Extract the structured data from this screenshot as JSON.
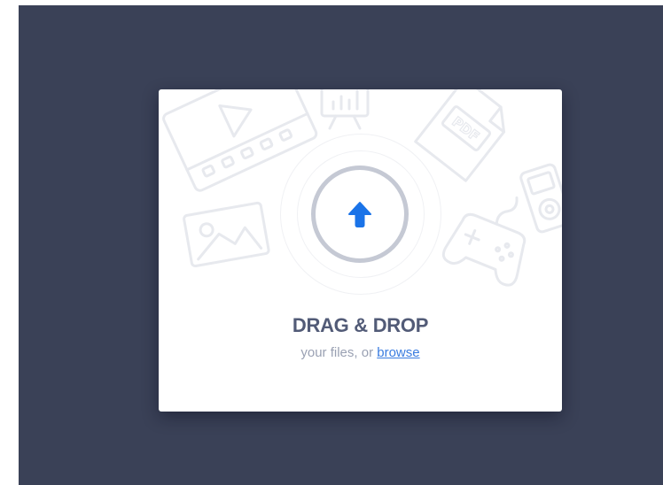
{
  "dropzone": {
    "title": "DRAG & DROP",
    "subtitle_prefix": "your files, or",
    "browse_link": "browse",
    "pdf_icon_text": "PDF"
  },
  "colors": {
    "page_background": "#3a4157",
    "card_background": "#ffffff",
    "accent": "#1a73e8",
    "ring": "#c5c9d4",
    "title": "#525b77",
    "subtitle": "#9aa1b3",
    "link": "#3b7de0",
    "decoration": "#e7e9ee"
  },
  "icons": {
    "upload": "arrow-up-icon",
    "decorations": [
      "video-film-icon",
      "presentation-chart-icon",
      "pdf-file-icon",
      "media-player-icon",
      "image-icon",
      "gamepad-icon"
    ]
  }
}
